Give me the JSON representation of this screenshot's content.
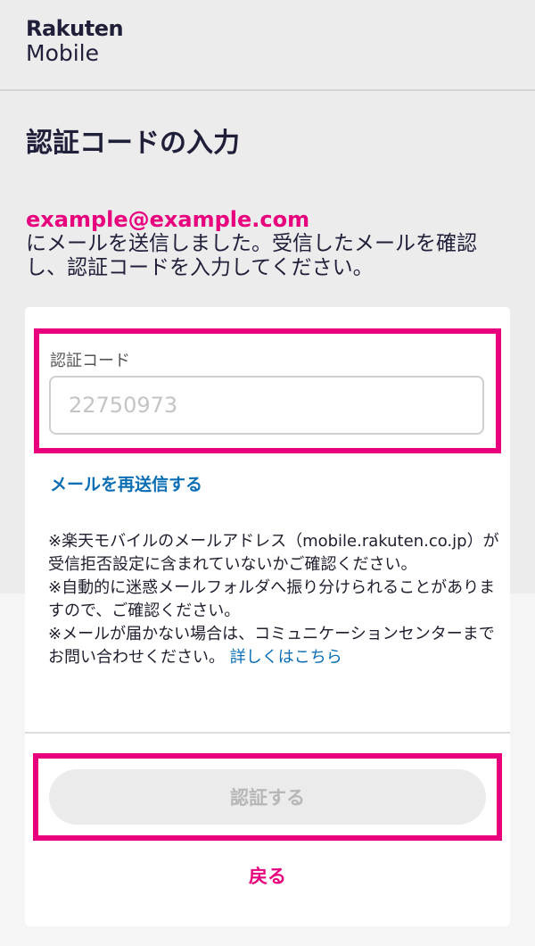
{
  "brand": {
    "line1": "Rakuten",
    "line2": "Mobile"
  },
  "page": {
    "title": "認証コードの入力",
    "email": "example@example.com",
    "instruction": "にメールを送信しました。受信したメールを確認し、認証コードを入力してください。"
  },
  "form": {
    "code_label": "認証コード",
    "code_placeholder": "22750973",
    "resend_link": "メールを再送信する",
    "notes": {
      "note1": "※楽天モバイルのメールアドレス（mobile.rakuten.co.jp）が受信拒否設定に含まれていないかご確認ください。",
      "note2": "※自動的に迷惑メールフォルダへ振り分けられることがありますので、ご確認ください。",
      "note3": "※メールが届かない場合は、コミュニケーションセンターまでお問い合わせください。",
      "details_link": "詳しくはこちら"
    },
    "submit_label": "認証する",
    "back_label": "戻る"
  },
  "colors": {
    "accent": "#e8007d",
    "link": "#0a6eb4",
    "text": "#1f1f3a",
    "background": "#ececec"
  }
}
